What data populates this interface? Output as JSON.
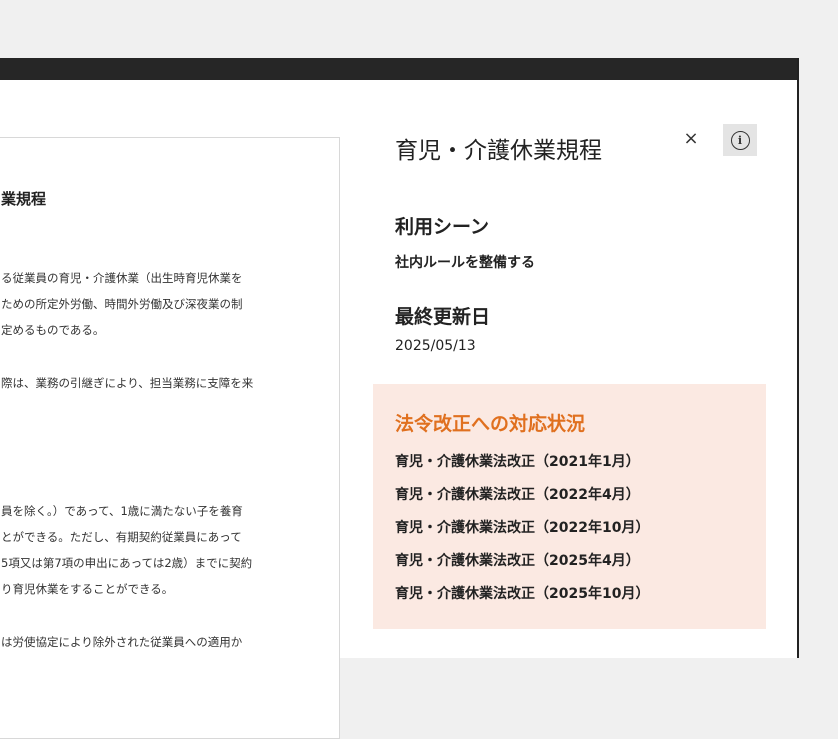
{
  "document": {
    "title_fragment": "業規程",
    "lines": [
      "る従業員の育児・介護休業（出生時育児休業を",
      "ための所定外労働、時間外労働及び深夜業の制",
      "定めるものである。",
      "際は、業務の引継ぎにより、担当業務に支障を来",
      "員を除く。）であって、1歳に満たない子を養育",
      "とができる。ただし、有期契約従業員にあって",
      "5項又は第7項の申出にあっては2歳）までに契約",
      "り育児休業をすることができる。",
      "は労使協定により除外された従業員への適用か"
    ]
  },
  "panel": {
    "title": "育児・介護休業規程",
    "close_icon": "×",
    "info_icon": "i",
    "scene": {
      "heading": "利用シーン",
      "value": "社内ルールを整備する"
    },
    "updated": {
      "heading": "最終更新日",
      "value": "2025/05/13"
    },
    "law": {
      "heading": "法令改正への対応状況",
      "accent_color": "#e0701f",
      "background_color": "#fbe9e2",
      "items": [
        "育児・介護休業法改正（2021年1月）",
        "育児・介護休業法改正（2022年4月）",
        "育児・介護休業法改正（2022年10月）",
        "育児・介護休業法改正（2025年4月）",
        "育児・介護休業法改正（2025年10月）"
      ]
    }
  }
}
